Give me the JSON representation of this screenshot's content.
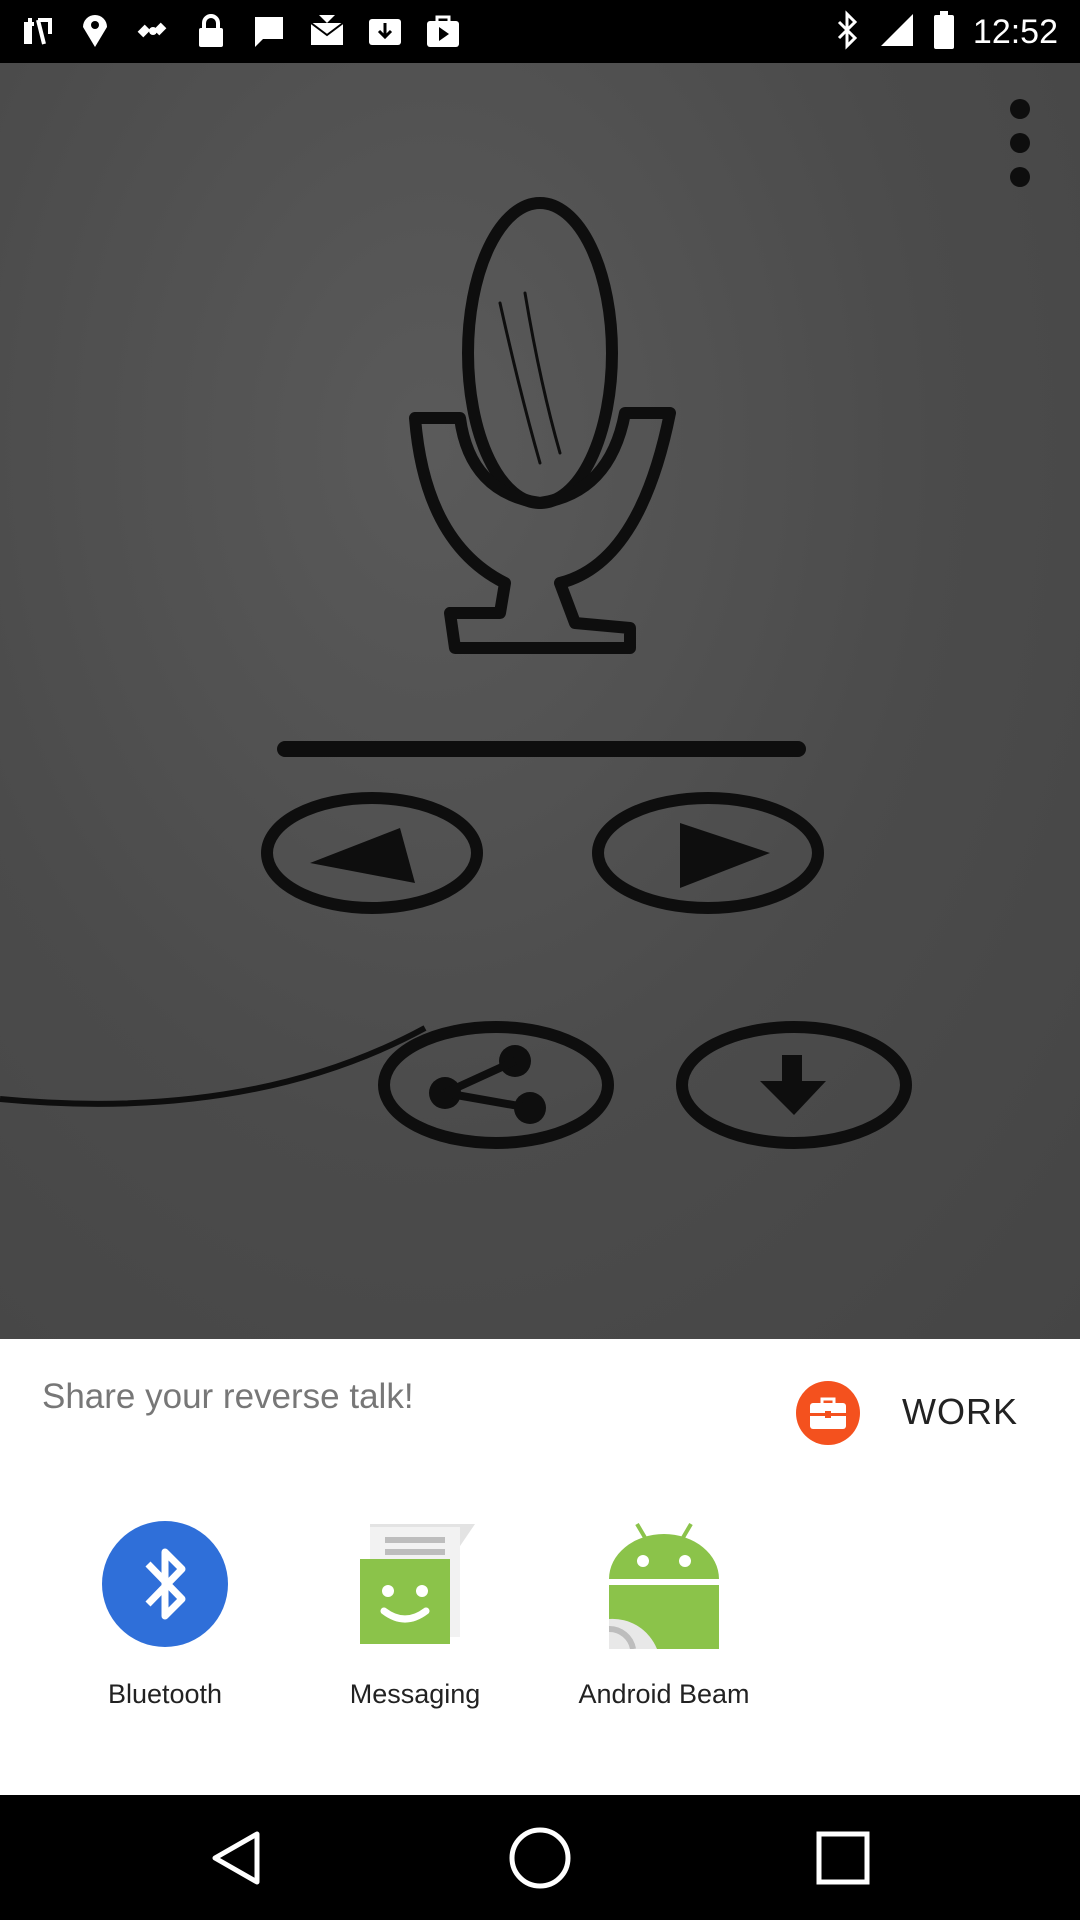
{
  "status_bar": {
    "time": "12:52",
    "left_icons": [
      "notification-icon",
      "fake-gps-icon",
      "satellite-icon",
      "lock-icon",
      "chat-icon",
      "mail-icon",
      "download-icon",
      "play-store-icon"
    ],
    "right_icons": [
      "bluetooth-icon",
      "signal-icon",
      "battery-icon"
    ]
  },
  "app": {
    "overflow_icon": "overflow-menu-icon",
    "buttons": [
      "microphone-icon",
      "reverse-play-icon",
      "play-icon",
      "share-icon",
      "download-icon"
    ]
  },
  "share_sheet": {
    "title": "Share your reverse talk!",
    "profile_label": "WORK",
    "accent": "#f4511e",
    "targets": [
      {
        "label": "Bluetooth",
        "icon": "bluetooth-icon",
        "color": "#2f6fd9"
      },
      {
        "label": "Messaging",
        "icon": "messaging-icon",
        "color": "#8bc34a"
      },
      {
        "label": "Android Beam",
        "icon": "android-beam-icon",
        "color": "#8bc34a"
      }
    ]
  },
  "nav_bar": {
    "icons": [
      "back-icon",
      "home-icon",
      "recents-icon"
    ]
  }
}
